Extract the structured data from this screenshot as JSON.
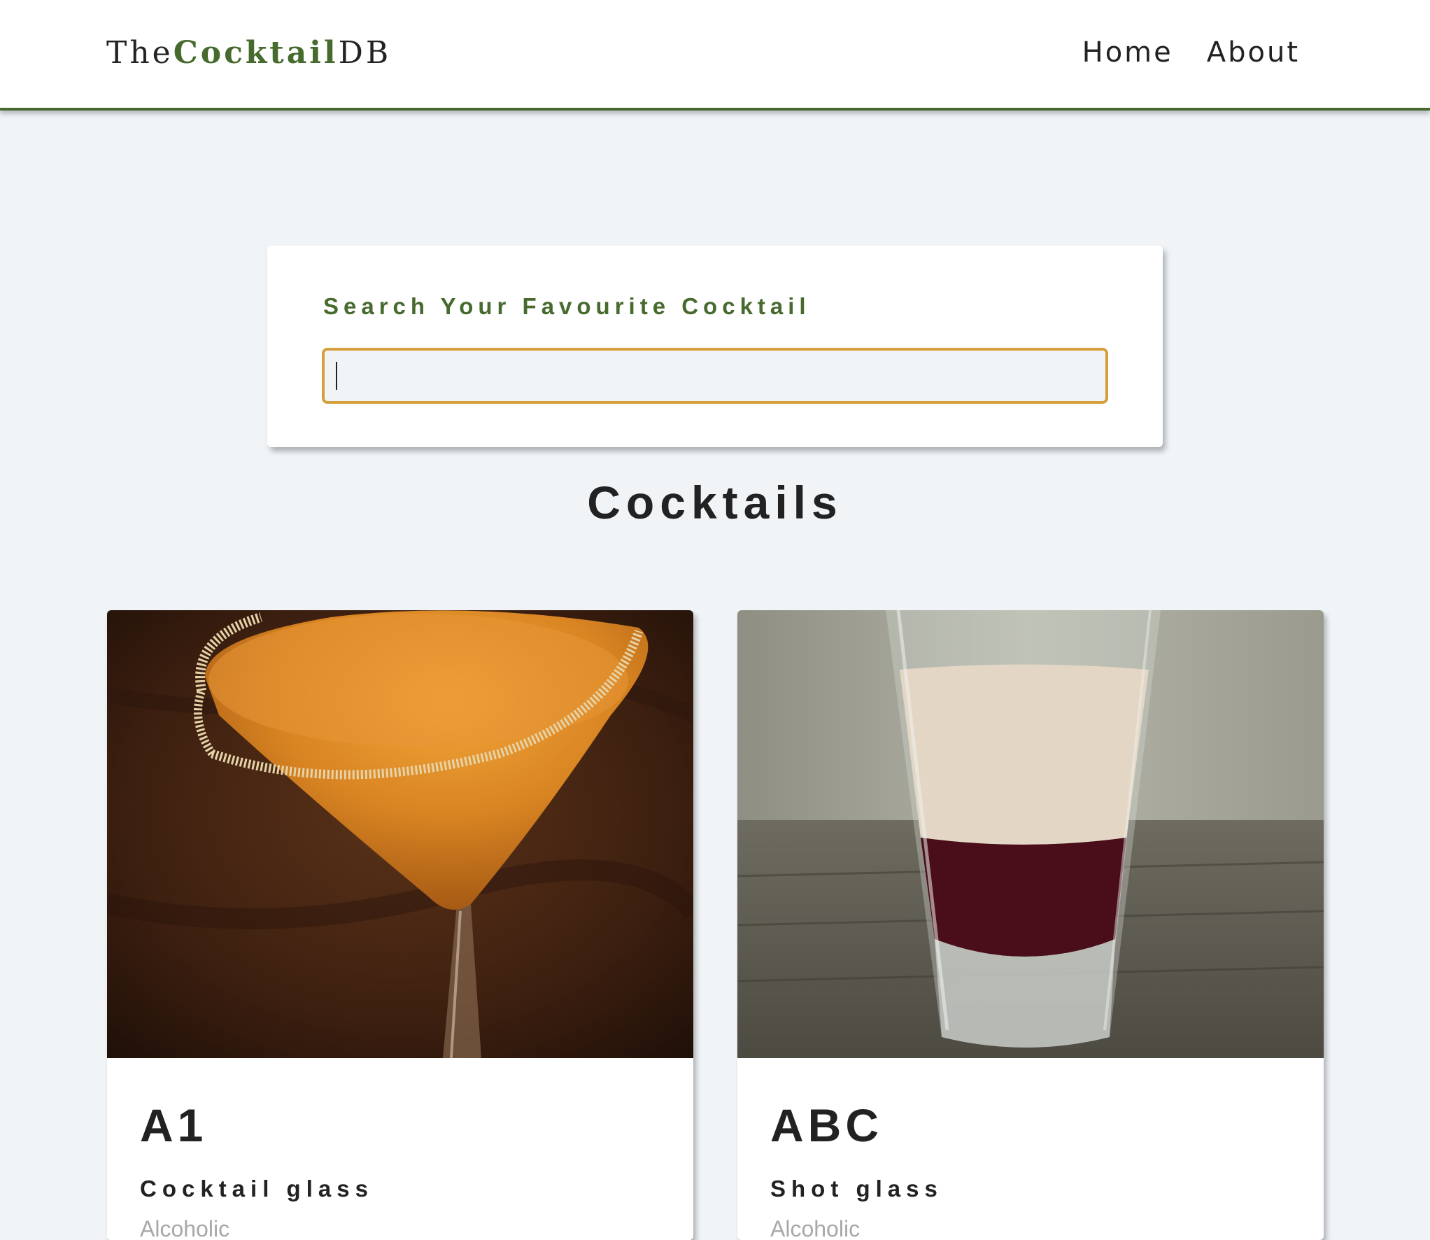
{
  "navbar": {
    "logo_prefix": "The",
    "logo_brand": "Cocktail",
    "logo_suffix": "DB",
    "links": [
      {
        "label": "Home"
      },
      {
        "label": "About"
      }
    ]
  },
  "search": {
    "label": "Search Your Favourite Cocktail",
    "value": ""
  },
  "section": {
    "title": "Cocktails"
  },
  "cocktails": [
    {
      "name": "A1",
      "glass": "Cocktail glass",
      "info": "Alcoholic"
    },
    {
      "name": "ABC",
      "glass": "Shot glass",
      "info": "Alcoholic"
    }
  ],
  "colors": {
    "brand_green": "#476a2e",
    "input_border": "#d79e3c",
    "page_background": "#f0f4f7"
  }
}
